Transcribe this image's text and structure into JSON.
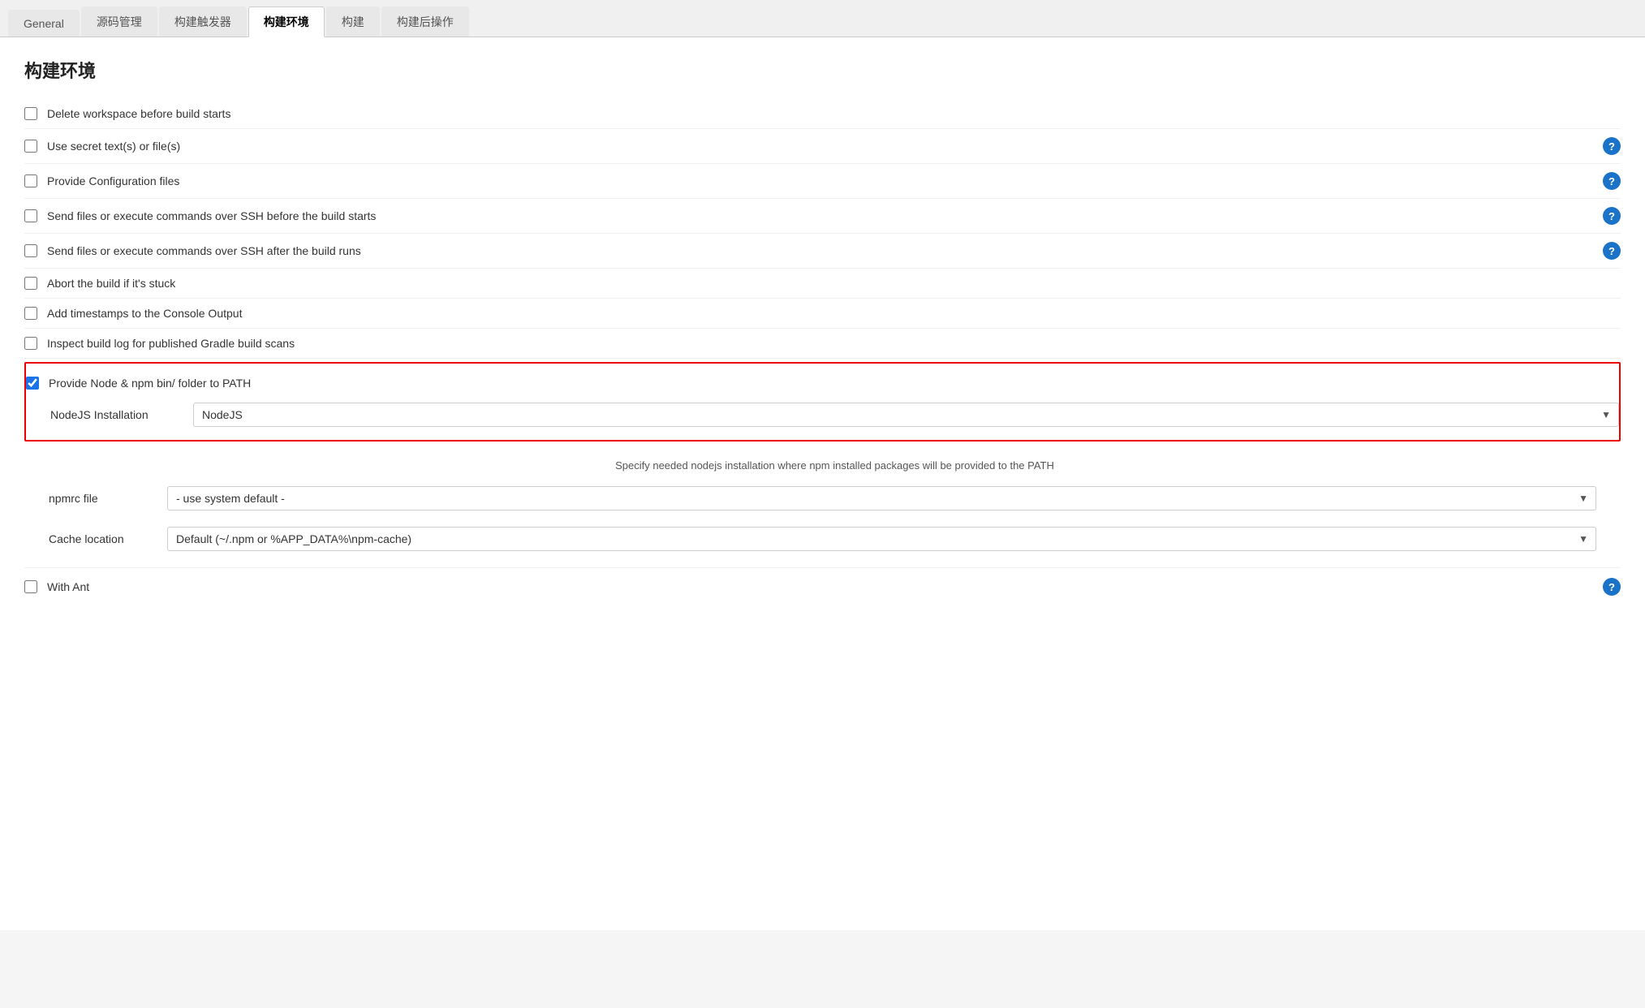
{
  "tabs": [
    {
      "id": "general",
      "label": "General",
      "active": false
    },
    {
      "id": "source",
      "label": "源码管理",
      "active": false
    },
    {
      "id": "triggers",
      "label": "构建触发器",
      "active": false
    },
    {
      "id": "env",
      "label": "构建环境",
      "active": true
    },
    {
      "id": "build",
      "label": "构建",
      "active": false
    },
    {
      "id": "post",
      "label": "构建后操作",
      "active": false
    }
  ],
  "pageTitle": "构建环境",
  "checkboxItems": [
    {
      "id": "delete-workspace",
      "label": "Delete workspace before build starts",
      "checked": false,
      "hasHelp": false
    },
    {
      "id": "use-secret",
      "label": "Use secret text(s) or file(s)",
      "checked": false,
      "hasHelp": true
    },
    {
      "id": "provide-config",
      "label": "Provide Configuration files",
      "checked": false,
      "hasHelp": true
    },
    {
      "id": "send-files-before",
      "label": "Send files or execute commands over SSH before the build starts",
      "checked": false,
      "hasHelp": true
    },
    {
      "id": "send-files-after",
      "label": "Send files or execute commands over SSH after the build runs",
      "checked": false,
      "hasHelp": true
    },
    {
      "id": "abort-stuck",
      "label": "Abort the build if it's stuck",
      "checked": false,
      "hasHelp": false
    },
    {
      "id": "timestamps",
      "label": "Add timestamps to the Console Output",
      "checked": false,
      "hasHelp": false
    },
    {
      "id": "inspect-gradle",
      "label": "Inspect build log for published Gradle build scans",
      "checked": false,
      "hasHelp": false
    }
  ],
  "nodeSection": {
    "checkboxLabel": "Provide Node & npm bin/ folder to PATH",
    "checked": true,
    "installationLabel": "NodeJS Installation",
    "installationOptions": [
      "NodeJS"
    ],
    "installationSelected": "NodeJS",
    "descriptionText": "Specify needed nodejs installation where npm installed packages will be provided to the PATH",
    "npmrcLabel": "npmrc file",
    "npmrcOptions": [
      "- use system default -"
    ],
    "npmrcSelected": "- use system default -",
    "cacheLocationLabel": "Cache location",
    "cacheLocationOptions": [
      "Default (~/.npm or %APP_DATA%\\npm-cache)"
    ],
    "cacheLocationSelected": "Default (~/.npm or %APP_DATA%\\npm-cache)"
  },
  "withAnt": {
    "label": "With Ant",
    "checked": false,
    "hasHelp": true
  },
  "help": {
    "icon": "?"
  }
}
